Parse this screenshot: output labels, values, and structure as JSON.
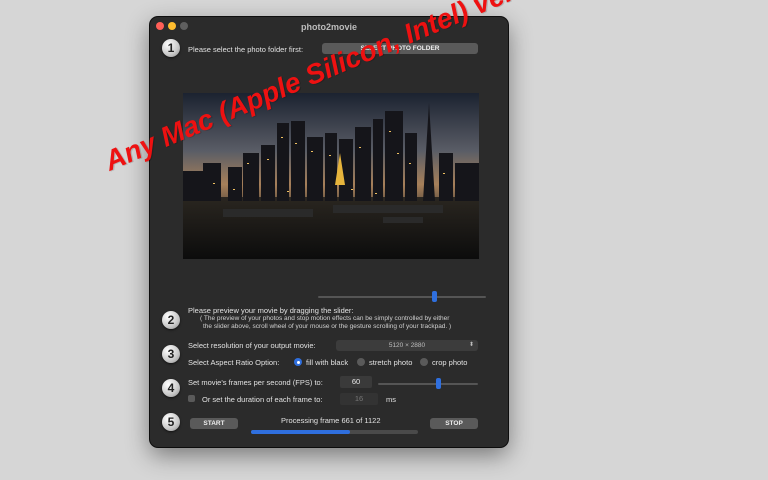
{
  "window": {
    "title": "photo2movie"
  },
  "steps": [
    "1",
    "2",
    "3",
    "4",
    "5"
  ],
  "folder": {
    "prompt": "Please select the photo folder first:",
    "button_label": "SELECT PHOTO FOLDER"
  },
  "preview": {
    "heading": "Please preview your movie by dragging the slider:",
    "note_line1": "( The preview of your photos and stop motion effects can be simply controlled by either",
    "note_line2": "the slider above, scroll wheel of your mouse or the gesture scrolling of your trackpad. )",
    "slider_value": 0.69
  },
  "resolution": {
    "label": "Select resolution of your  output movie:",
    "selected": "5120 × 2880",
    "arrow_icon": "updown-chevron-icon"
  },
  "aspect": {
    "label": "Select Aspect Ratio Option:",
    "options": [
      "fill with black",
      "stretch photo",
      "crop photo"
    ],
    "selected_index": 0
  },
  "fps": {
    "label": "Set movie's frames per second (FPS) to:",
    "value": "60",
    "slider_value": 0.6
  },
  "duration": {
    "label": "Or set the duration of each frame to:",
    "value": "16",
    "unit": "ms",
    "checked": false
  },
  "controls": {
    "start_label": "START",
    "stop_label": "STOP",
    "status": "Processing frame 661 of 1122",
    "progress": 0.59
  },
  "overlay_text": "Any Mac (Apple Silicon, Intel) version",
  "colors": {
    "accent": "#2f6fde",
    "overlay": "#ee1111",
    "window_bg": "#2b2b2b"
  }
}
